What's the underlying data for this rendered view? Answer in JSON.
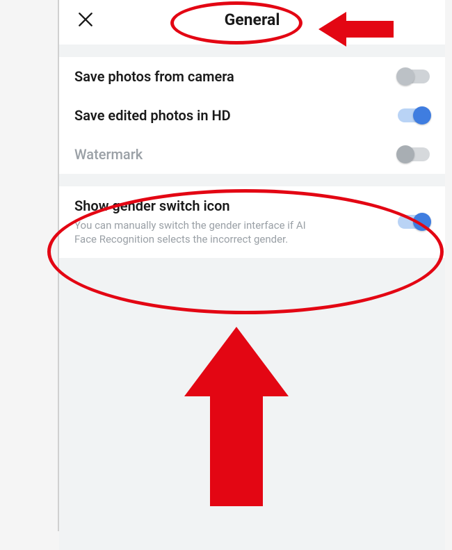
{
  "header": {
    "title": "General"
  },
  "settings": {
    "save_photos": {
      "label": "Save photos from camera",
      "on": false
    },
    "save_hd": {
      "label": "Save edited photos in HD",
      "on": true
    },
    "watermark": {
      "label": "Watermark",
      "on": false,
      "disabled": true
    },
    "gender_switch": {
      "label": "Show gender switch icon",
      "description": "You can manually switch the gender interface if AI Face Recognition selects the incorrect gender.",
      "on": true
    }
  },
  "colors": {
    "annotation": "#e30613",
    "accent": "#3f7de0"
  }
}
